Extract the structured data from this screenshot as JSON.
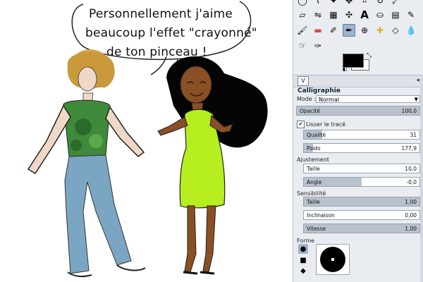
{
  "speech": {
    "line1": "Personnellement j'aime",
    "line2": "beaucoup l'effet \"crayonné\"",
    "line3": "de ton pinceau !"
  },
  "tool_options": {
    "title": "Calligraphie",
    "mode_label": "Mode :",
    "mode_value": "Normal",
    "opacity_label": "Opacité",
    "opacity_value": "100,0",
    "opacity_level": 1.0,
    "smooth_label": "Lisser le tracé",
    "smooth_checked": true,
    "quality_label": "Qualité",
    "quality_value": "31",
    "quality_level": 0.16,
    "weight_label": "Poids",
    "weight_value": "177,9",
    "weight_level": 0.08,
    "adjust_header": "Ajustement",
    "size_label": "Taille",
    "size_value": "10,0",
    "size_level": 0.0,
    "angle_label": "Angle",
    "angle_value": "-0,0",
    "angle_level": 0.5,
    "sensitivity_header": "Sensibilité",
    "sens_size_label": "Taille",
    "sens_size_value": "1,00",
    "sens_size_level": 1.0,
    "inclination_label": "Inclinaison",
    "inclination_value": "0,00",
    "inclination_level": 0.0,
    "speed_label": "Vitesse",
    "speed_value": "1,00",
    "speed_level": 1.0,
    "shape_header": "Forme"
  },
  "tab_label": "V",
  "colors": {
    "panel_bg": "#e9edf2",
    "fill": "#b9c2cc",
    "dress": "#b6ee1f",
    "top": "#3f8a3a",
    "jeans": "#7aa6c4",
    "hair_blonde": "#d2a94a",
    "skin_dark": "#8a4f24",
    "skin_light": "#efd8c8"
  },
  "toolbox_icons": [
    "ellipse-select-icon",
    "free-select-icon",
    "fuzzy-select-icon",
    "move-icon",
    "crop-icon",
    "rotate-icon",
    "scale-icon",
    "perspective-icon",
    "flip-icon",
    "cage-icon",
    "text-icon",
    "bucket-fill-icon",
    "blend-icon",
    "pencil-icon",
    "paintbrush-icon",
    "eraser-icon",
    "airbrush-icon",
    "ink-icon",
    "clone-icon",
    "heal-icon",
    "blur-icon",
    "smudge-icon",
    "dodge-icon"
  ]
}
